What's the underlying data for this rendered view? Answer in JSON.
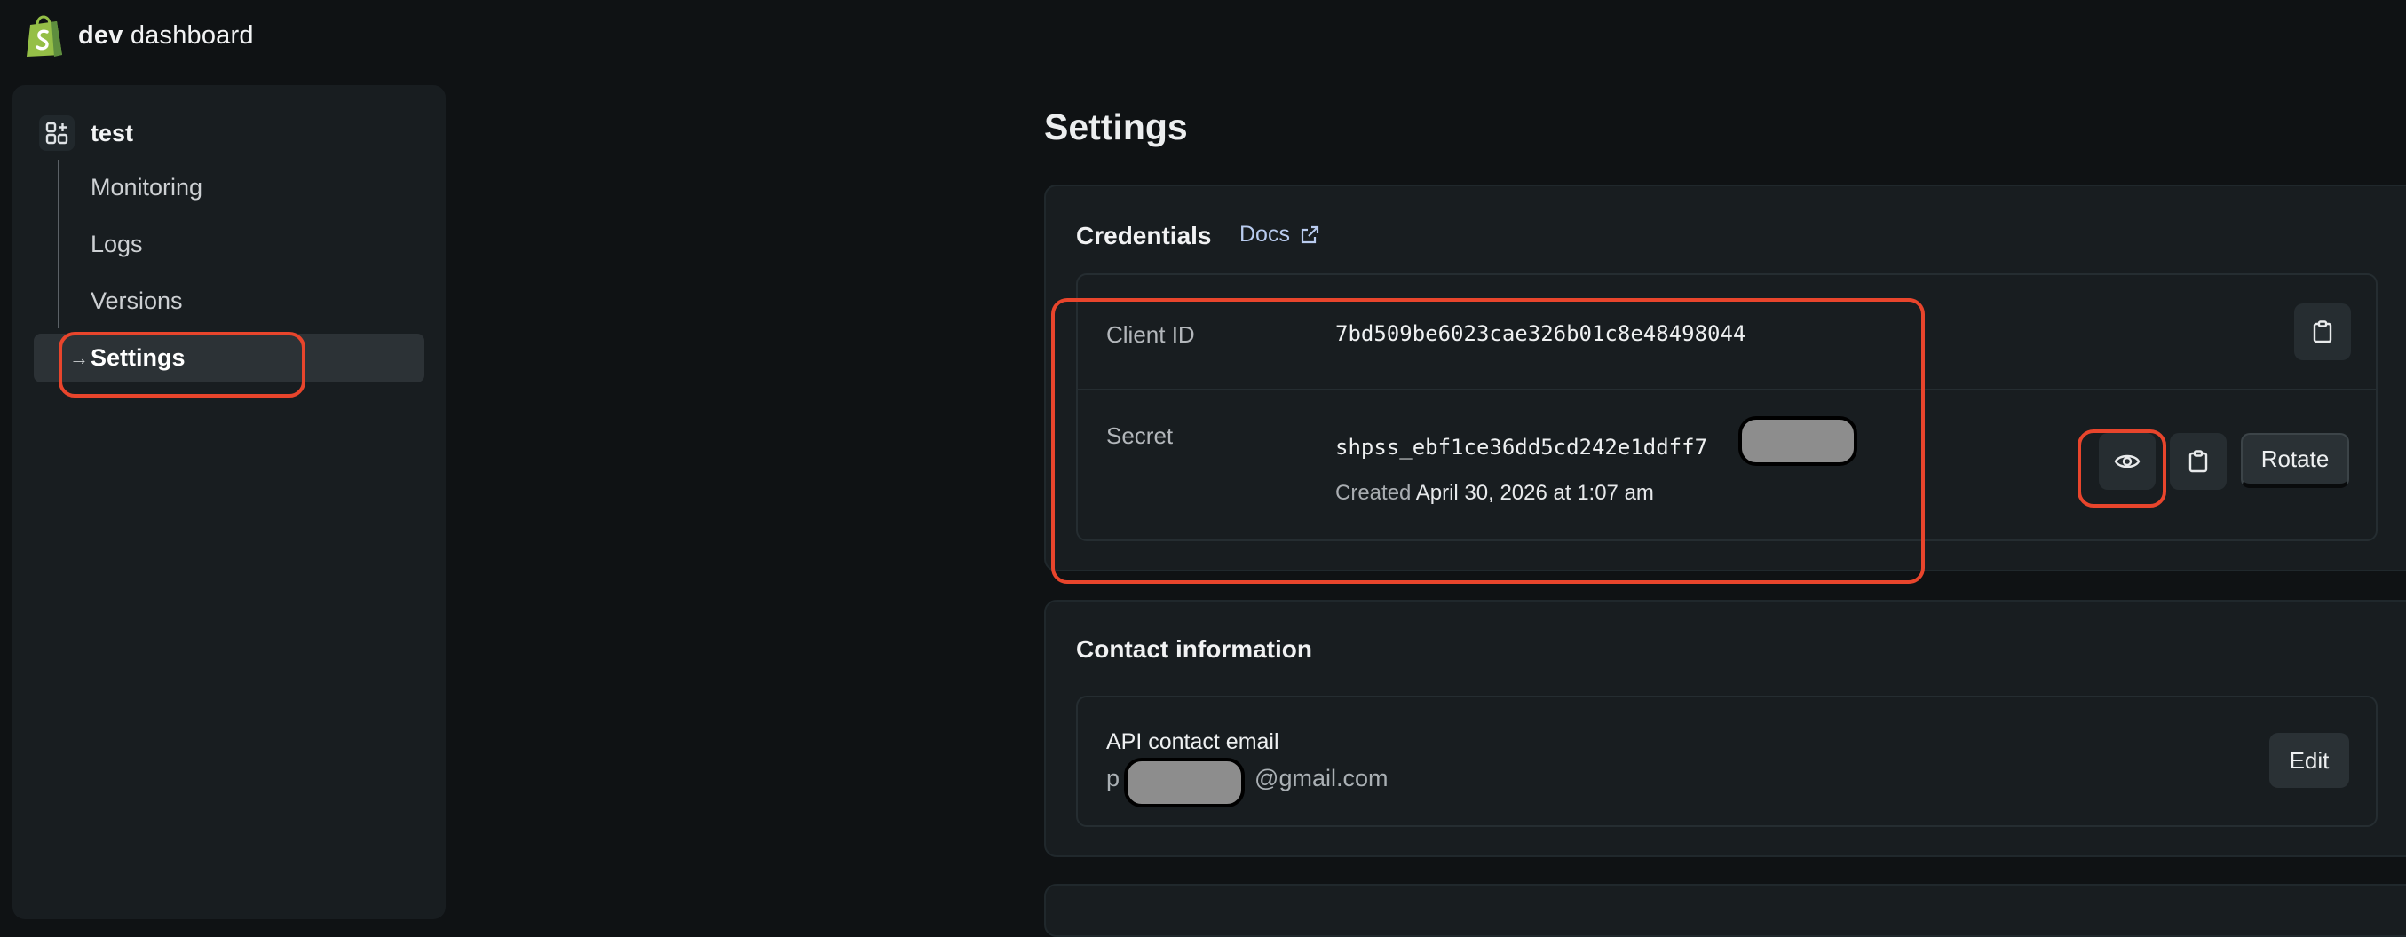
{
  "brand": {
    "bold": "dev",
    "rest": "dashboard"
  },
  "sidebar": {
    "app_name": "test",
    "items": [
      {
        "label": "Monitoring"
      },
      {
        "label": "Logs"
      },
      {
        "label": "Versions"
      },
      {
        "label": "Settings",
        "active": true
      }
    ]
  },
  "main": {
    "title": "Settings",
    "credentials": {
      "title": "Credentials",
      "docs_label": "Docs",
      "client_id_label": "Client ID",
      "client_id_value": "7bd509be6023cae326b01c8e48498044",
      "secret_label": "Secret",
      "secret_value": "shpss_ebf1ce36dd5cd242e1ddff7",
      "created_prefix": "Created",
      "created_date": "April 30, 2026 at 1:07 am",
      "rotate_label": "Rotate"
    },
    "contact": {
      "title": "Contact information",
      "api_email_label": "API contact email",
      "email_prefix": "p",
      "email_suffix": "@gmail.com",
      "edit_label": "Edit"
    }
  },
  "colors": {
    "background": "#0f1214",
    "surface": "#181d20",
    "annotation": "#e8452c",
    "brand_green": "#95bf47"
  },
  "icons": [
    "shopify-bag-icon",
    "app-grid-icon",
    "external-link-icon",
    "clipboard-icon",
    "eye-icon",
    "arrow-right-icon"
  ]
}
